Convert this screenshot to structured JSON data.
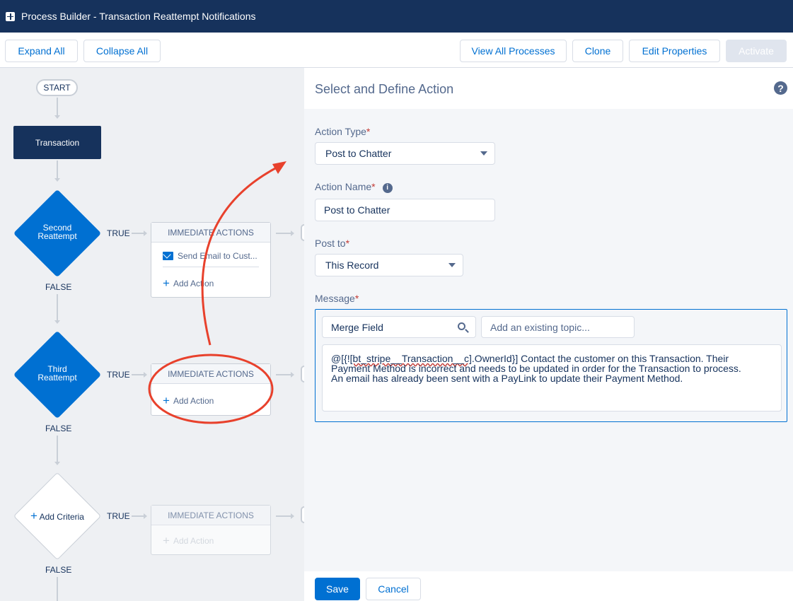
{
  "titlebar": {
    "title": "Process Builder - Transaction Reattempt Notifications"
  },
  "toolbar": {
    "expand_all": "Expand All",
    "collapse_all": "Collapse All",
    "view_all_processes": "View All Processes",
    "clone": "Clone",
    "edit_properties": "Edit Properties",
    "activate": "Activate"
  },
  "canvas": {
    "start": "START",
    "object": "Transaction",
    "criteria": [
      {
        "label_1": "Second",
        "label_2": "Reattempt",
        "true": "TRUE",
        "false": "FALSE",
        "actions_header": "IMMEDIATE ACTIONS",
        "action_1": "Send Email to Cust...",
        "add_action": "Add Action"
      },
      {
        "label_1": "Third",
        "label_2": "Reattempt",
        "true": "TRUE",
        "false": "FALSE",
        "actions_header": "IMMEDIATE ACTIONS",
        "add_action": "Add Action"
      },
      {
        "label": "Add Criteria",
        "true": "TRUE",
        "false": "FALSE",
        "actions_header": "IMMEDIATE ACTIONS",
        "add_action": "Add Action"
      }
    ]
  },
  "panel": {
    "title": "Select and Define Action",
    "action_type_label": "Action Type",
    "action_type_value": "Post to Chatter",
    "action_name_label": "Action Name",
    "action_name_value": "Post to Chatter",
    "post_to_label": "Post to",
    "post_to_value": "This Record",
    "message_label": "Message",
    "merge_field_placeholder": "Merge Field",
    "topic_placeholder": "Add an existing topic...",
    "message_line_1": "@[{!",
    "message_token": "[bt_stripe__Transaction__c]",
    "message_line_1_rest": ".OwnerId}] Contact the customer on this Transaction. Their",
    "message_line_2": "Payment Method is incorrect and needs to be updated in order for the Transaction to process.",
    "message_line_3": "An email has already been sent with a PayLink to update their Payment Method.",
    "save": "Save",
    "cancel": "Cancel"
  },
  "colors": {
    "navy": "#16325c",
    "brand": "#0070d2",
    "annotation": "#e8412c"
  }
}
